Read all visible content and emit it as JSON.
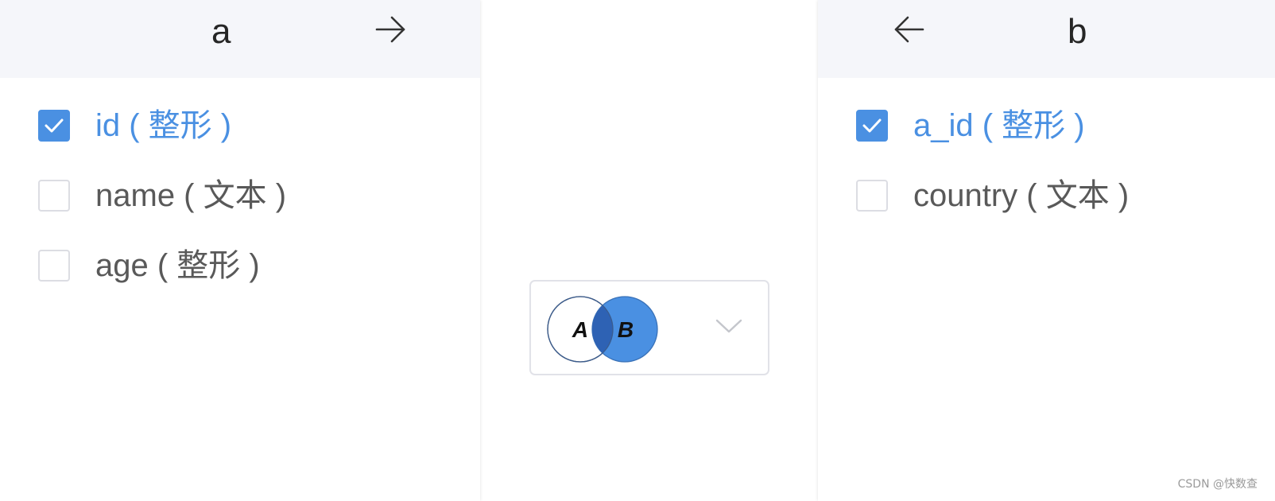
{
  "table_a": {
    "title": "a",
    "arrow_icon": "arrow-right-icon",
    "fields": [
      {
        "label": "id ( 整形 )",
        "checked": true
      },
      {
        "label": "name ( 文本 )",
        "checked": false
      },
      {
        "label": "age ( 整形 )",
        "checked": false
      }
    ]
  },
  "table_b": {
    "title": "b",
    "arrow_icon": "arrow-left-icon",
    "fields": [
      {
        "label": "a_id ( 整形 )",
        "checked": true
      },
      {
        "label": "country ( 文本 )",
        "checked": false
      }
    ]
  },
  "join_select": {
    "selected_icon": "left-join-venn-icon",
    "circle_a_label": "A",
    "circle_b_label": "B",
    "dropdown_icon": "chevron-down-icon"
  },
  "watermark": "CSDN @快数查",
  "colors": {
    "accent": "#4a90e2",
    "header_bg": "#f5f6fa",
    "venn_overlap": "#2e62b4"
  }
}
